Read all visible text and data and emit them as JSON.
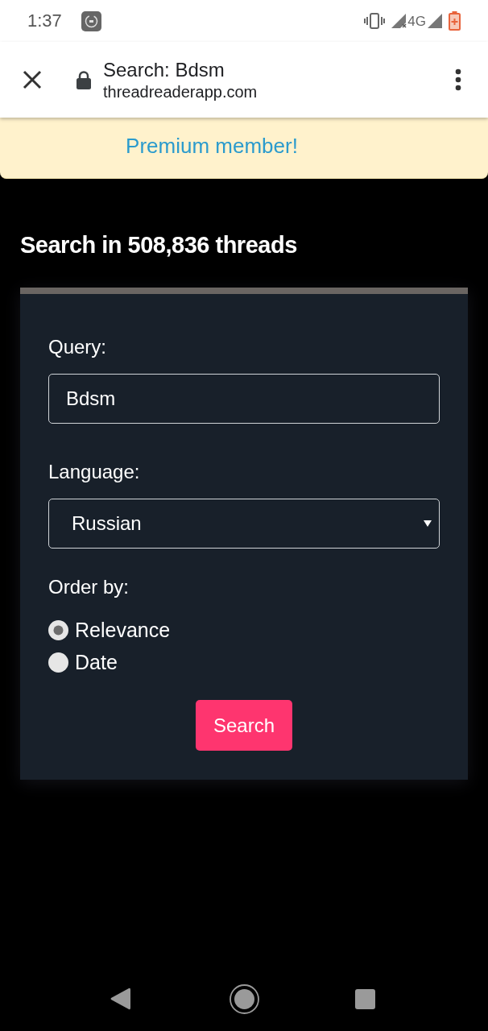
{
  "status_bar": {
    "time": "1:37",
    "network": "4G"
  },
  "browser_bar": {
    "title": "Search: Bdsm",
    "url": "threadreaderapp.com"
  },
  "banner": {
    "link": "Premium member!"
  },
  "heading": "Search in 508,836 threads",
  "form": {
    "query": {
      "label": "Query:",
      "value": "Bdsm"
    },
    "language": {
      "label": "Language:",
      "value": "Russian"
    },
    "order": {
      "label": "Order by:",
      "options": [
        {
          "label": "Relevance",
          "selected": true
        },
        {
          "label": "Date",
          "selected": false
        }
      ]
    },
    "submit": "Search"
  }
}
